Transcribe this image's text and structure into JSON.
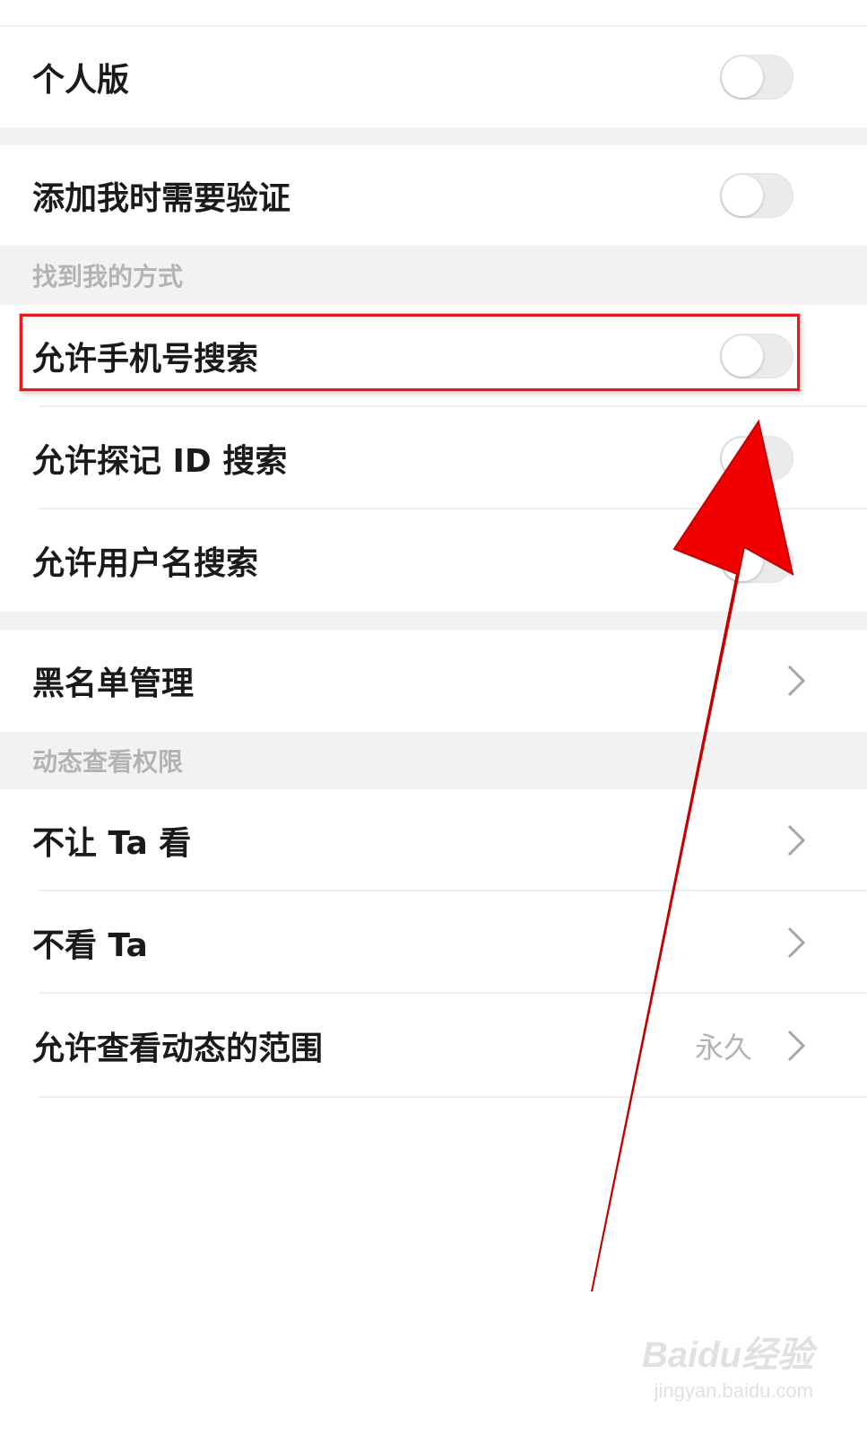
{
  "settings": {
    "personal_version": "个人版",
    "verify_add": "添加我时需要验证",
    "find_me_header": "找到我的方式",
    "allow_phone_search": "允许手机号搜索",
    "allow_id_search": "允许探记 ID 搜索",
    "allow_username_search": "允许用户名搜索",
    "blacklist": "黑名单管理",
    "moments_header": "动态查看权限",
    "hide_from": "不让 Ta 看",
    "dont_see": "不看 Ta",
    "visible_range": "允许查看动态的范围",
    "visible_range_value": "永久"
  },
  "toggles": {
    "personal_version": false,
    "verify_add": false,
    "allow_phone_search": false,
    "allow_id_search": false,
    "allow_username_search": false
  },
  "watermark": {
    "main": "Baidu经验",
    "sub": "jingyan.baidu.com"
  },
  "colors": {
    "highlight": "#e8191e",
    "arrow": "#f20000",
    "background": "#f2f2f2"
  }
}
